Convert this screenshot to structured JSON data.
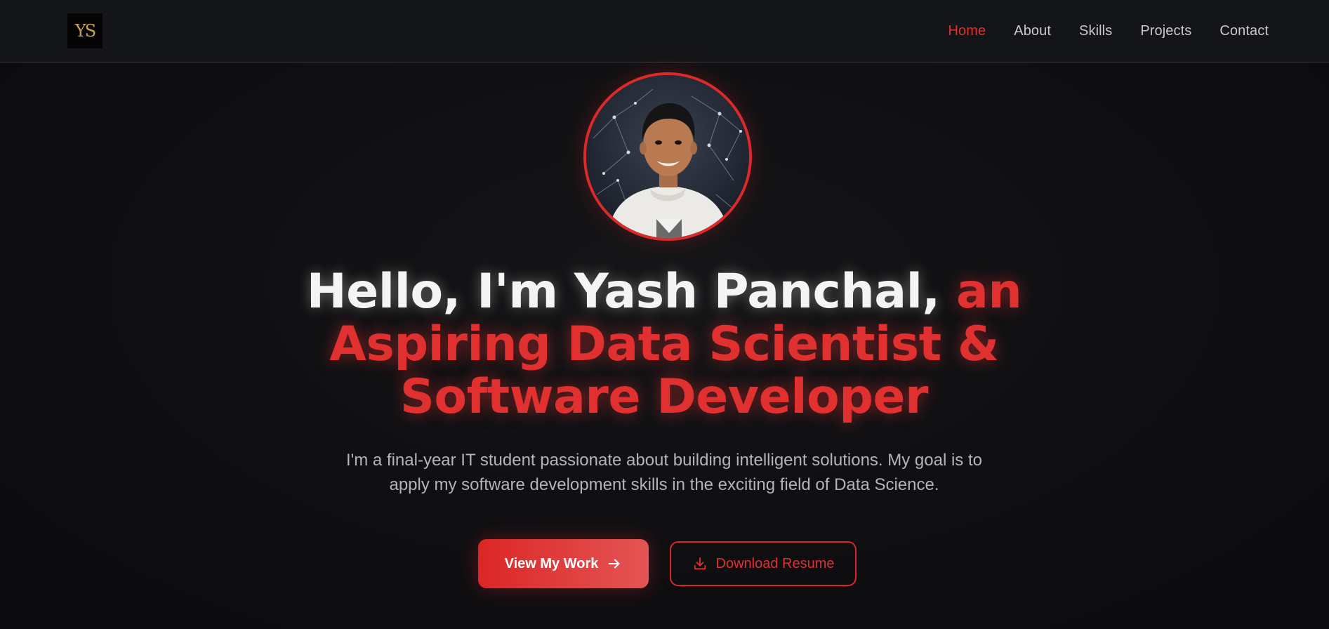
{
  "navbar": {
    "logo_text": "YS",
    "links": [
      {
        "label": "Home",
        "active": true
      },
      {
        "label": "About",
        "active": false
      },
      {
        "label": "Skills",
        "active": false
      },
      {
        "label": "Projects",
        "active": false
      },
      {
        "label": "Contact",
        "active": false
      }
    ]
  },
  "hero": {
    "headline_white": "Hello, I'm Yash Panchal,",
    "headline_red_1": "an",
    "headline_red_2": "Aspiring Data Scientist &",
    "headline_red_3": "Software Developer",
    "subtitle_line_1": "I'm a final-year IT student passionate about building intelligent solutions. My goal is to",
    "subtitle_line_2": "apply my software development skills in the exciting field of Data Science.",
    "primary_button": {
      "label": "View My Work",
      "icon": "arrow-right-icon"
    },
    "secondary_button": {
      "label": "Download Resume",
      "icon": "download-icon"
    }
  },
  "colors": {
    "accent": "#dc2626",
    "background": "#0f0f12",
    "navbar": "#141518",
    "logo_gold": "#c9a24a"
  }
}
